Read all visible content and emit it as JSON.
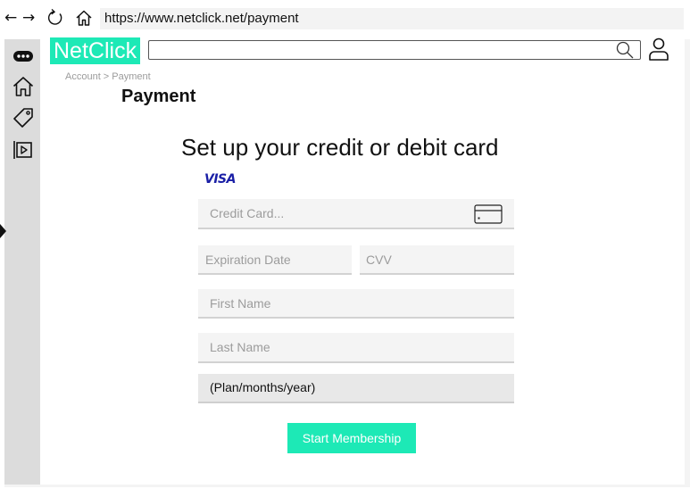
{
  "browser": {
    "back_glyph": "←",
    "forward_glyph": "→",
    "url": "https://www.netclick.net/payment"
  },
  "sidebar": {
    "icons": [
      "menu-icon",
      "home-icon",
      "tag-icon",
      "play-icon"
    ]
  },
  "header": {
    "logo": "NetClick",
    "search": {
      "value": "",
      "placeholder": ""
    }
  },
  "breadcrumb": "Account > Payment",
  "page_title": "Payment",
  "form": {
    "heading": "Set up your credit or debit card",
    "card_brand": "VISA",
    "credit_card_placeholder": "Credit Card...",
    "expiration_placeholder": "Expiration Date",
    "cvv_placeholder": "CVV",
    "first_name_placeholder": "First Name",
    "last_name_placeholder": "Last Name",
    "plan_value": "(Plan/months/year)",
    "submit_label": "Start Membership"
  },
  "colors": {
    "accent": "#1de9b6",
    "visa_blue": "#1a1fa6",
    "sidebar": "#dcdcdc",
    "field_bg": "#f4f4f4"
  }
}
